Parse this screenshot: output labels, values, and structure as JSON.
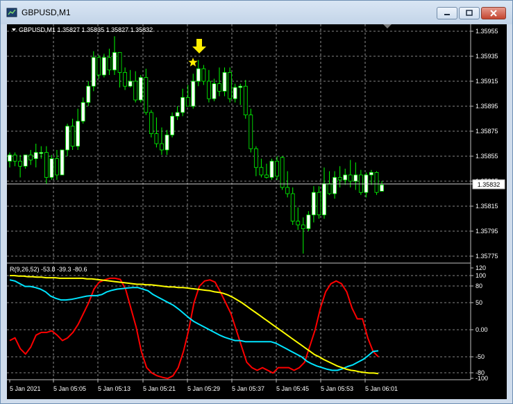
{
  "window": {
    "title": "GBPUSD,M1"
  },
  "chart_header": {
    "text": "GBPUSD,M1  1.35827 1.35835 1.35827 1.35832"
  },
  "indicator_header": {
    "text": "R(9,26,52) -53.8 -39.3 -80.6"
  },
  "price_axis": {
    "labels": [
      "1.35955",
      "1.35935",
      "1.35915",
      "1.35895",
      "1.35875",
      "1.35855",
      "1.35835",
      "1.35815",
      "1.35795",
      "1.35775"
    ],
    "current_price": "1.35832"
  },
  "indicator_axis": {
    "labels": [
      "120",
      "100",
      "80",
      "50",
      "0.00",
      "-50",
      "-80",
      "-100"
    ]
  },
  "time_axis": {
    "labels": [
      "5 Jan 2021",
      "5 Jan 05:05",
      "5 Jan 05:13",
      "5 Jan 05:21",
      "5 Jan 05:29",
      "5 Jan 05:37",
      "5 Jan 05:45",
      "5 Jan 05:53",
      "5 Jan 06:01"
    ]
  },
  "colors": {
    "bull": "#ffffff",
    "bear": "#000000",
    "candle_border": "#00ff00",
    "grid": "#b3b3b3",
    "fast_line": "#ff0000",
    "mid_line": "#00e5ff",
    "slow_line": "#ffff00",
    "marker": "#ffee00"
  },
  "markers": [
    {
      "icon": "arrow-down-icon"
    },
    {
      "icon": "star-icon"
    }
  ],
  "chart_data": [
    {
      "type": "candlestick",
      "title": "GBPUSD,M1",
      "ylim": [
        1.3577,
        1.3596
      ],
      "candles": [
        {
          "o": 1.35851,
          "h": 1.35858,
          "l": 1.35846,
          "c": 1.35856
        },
        {
          "o": 1.35856,
          "h": 1.35858,
          "l": 1.35847,
          "c": 1.35851
        },
        {
          "o": 1.35851,
          "h": 1.35856,
          "l": 1.35838,
          "c": 1.35847
        },
        {
          "o": 1.35847,
          "h": 1.35856,
          "l": 1.35845,
          "c": 1.35856
        },
        {
          "o": 1.35856,
          "h": 1.3586,
          "l": 1.35848,
          "c": 1.35852
        },
        {
          "o": 1.35853,
          "h": 1.35865,
          "l": 1.35846,
          "c": 1.35858
        },
        {
          "o": 1.35858,
          "h": 1.35863,
          "l": 1.35853,
          "c": 1.35858
        },
        {
          "o": 1.35858,
          "h": 1.35863,
          "l": 1.35833,
          "c": 1.35838
        },
        {
          "o": 1.35838,
          "h": 1.35856,
          "l": 1.35836,
          "c": 1.35853
        },
        {
          "o": 1.35853,
          "h": 1.3586,
          "l": 1.35836,
          "c": 1.3584
        },
        {
          "o": 1.3584,
          "h": 1.3586,
          "l": 1.3584,
          "c": 1.3586
        },
        {
          "o": 1.3586,
          "h": 1.35881,
          "l": 1.35855,
          "c": 1.35879
        },
        {
          "o": 1.35879,
          "h": 1.35885,
          "l": 1.3586,
          "c": 1.35863
        },
        {
          "o": 1.35863,
          "h": 1.35893,
          "l": 1.3586,
          "c": 1.35883
        },
        {
          "o": 1.35883,
          "h": 1.35902,
          "l": 1.35881,
          "c": 1.35898
        },
        {
          "o": 1.35898,
          "h": 1.35915,
          "l": 1.35895,
          "c": 1.35911
        },
        {
          "o": 1.35911,
          "h": 1.35939,
          "l": 1.35907,
          "c": 1.35934
        },
        {
          "o": 1.35934,
          "h": 1.35936,
          "l": 1.35917,
          "c": 1.3592
        },
        {
          "o": 1.3592,
          "h": 1.35937,
          "l": 1.35918,
          "c": 1.35934
        },
        {
          "o": 1.35934,
          "h": 1.35941,
          "l": 1.3592,
          "c": 1.35924
        },
        {
          "o": 1.35924,
          "h": 1.35951,
          "l": 1.3592,
          "c": 1.35938
        },
        {
          "o": 1.35938,
          "h": 1.35938,
          "l": 1.3591,
          "c": 1.35922
        },
        {
          "o": 1.35922,
          "h": 1.35926,
          "l": 1.35908,
          "c": 1.35911
        },
        {
          "o": 1.35911,
          "h": 1.35924,
          "l": 1.3591,
          "c": 1.35915
        },
        {
          "o": 1.35915,
          "h": 1.35923,
          "l": 1.35898,
          "c": 1.359
        },
        {
          "o": 1.359,
          "h": 1.3592,
          "l": 1.35898,
          "c": 1.35918
        },
        {
          "o": 1.35918,
          "h": 1.35925,
          "l": 1.35888,
          "c": 1.3589
        },
        {
          "o": 1.3589,
          "h": 1.35892,
          "l": 1.3587,
          "c": 1.35873
        },
        {
          "o": 1.35873,
          "h": 1.35886,
          "l": 1.35862,
          "c": 1.35865
        },
        {
          "o": 1.35865,
          "h": 1.35878,
          "l": 1.35856,
          "c": 1.3586
        },
        {
          "o": 1.3586,
          "h": 1.35876,
          "l": 1.35856,
          "c": 1.35872
        },
        {
          "o": 1.35872,
          "h": 1.3589,
          "l": 1.3587,
          "c": 1.35887
        },
        {
          "o": 1.35887,
          "h": 1.35895,
          "l": 1.35884,
          "c": 1.3589
        },
        {
          "o": 1.3589,
          "h": 1.35909,
          "l": 1.35887,
          "c": 1.35902
        },
        {
          "o": 1.35902,
          "h": 1.35912,
          "l": 1.359,
          "c": 1.35895
        },
        {
          "o": 1.35895,
          "h": 1.35921,
          "l": 1.35893,
          "c": 1.35915
        },
        {
          "o": 1.35915,
          "h": 1.35932,
          "l": 1.35911,
          "c": 1.35925
        },
        {
          "o": 1.35925,
          "h": 1.35928,
          "l": 1.35912,
          "c": 1.35915
        },
        {
          "o": 1.35915,
          "h": 1.35924,
          "l": 1.35898,
          "c": 1.35901
        },
        {
          "o": 1.35901,
          "h": 1.35917,
          "l": 1.35899,
          "c": 1.35913
        },
        {
          "o": 1.35913,
          "h": 1.35926,
          "l": 1.35903,
          "c": 1.35907
        },
        {
          "o": 1.35907,
          "h": 1.35926,
          "l": 1.35903,
          "c": 1.35922
        },
        {
          "o": 1.35922,
          "h": 1.35926,
          "l": 1.35898,
          "c": 1.35901
        },
        {
          "o": 1.35901,
          "h": 1.35913,
          "l": 1.35898,
          "c": 1.3591
        },
        {
          "o": 1.3591,
          "h": 1.35913,
          "l": 1.35896,
          "c": 1.35911
        },
        {
          "o": 1.35911,
          "h": 1.35916,
          "l": 1.35885,
          "c": 1.35888
        },
        {
          "o": 1.35888,
          "h": 1.35893,
          "l": 1.35858,
          "c": 1.35861
        },
        {
          "o": 1.35861,
          "h": 1.35863,
          "l": 1.35839,
          "c": 1.35846
        },
        {
          "o": 1.35846,
          "h": 1.35853,
          "l": 1.35838,
          "c": 1.3584
        },
        {
          "o": 1.3584,
          "h": 1.35849,
          "l": 1.35837,
          "c": 1.35838
        },
        {
          "o": 1.35838,
          "h": 1.35853,
          "l": 1.35836,
          "c": 1.35851
        },
        {
          "o": 1.35851,
          "h": 1.35855,
          "l": 1.35836,
          "c": 1.35839
        },
        {
          "o": 1.35854,
          "h": 1.35855,
          "l": 1.35828,
          "c": 1.3583
        },
        {
          "o": 1.3583,
          "h": 1.35843,
          "l": 1.35822,
          "c": 1.35825
        },
        {
          "o": 1.35825,
          "h": 1.3583,
          "l": 1.358,
          "c": 1.35803
        },
        {
          "o": 1.35803,
          "h": 1.35814,
          "l": 1.35796,
          "c": 1.358
        },
        {
          "o": 1.358,
          "h": 1.35806,
          "l": 1.35777,
          "c": 1.35797
        },
        {
          "o": 1.35797,
          "h": 1.35811,
          "l": 1.35795,
          "c": 1.35808
        },
        {
          "o": 1.35808,
          "h": 1.35831,
          "l": 1.35802,
          "c": 1.35826
        },
        {
          "o": 1.35826,
          "h": 1.35831,
          "l": 1.35805,
          "c": 1.35808
        },
        {
          "o": 1.35808,
          "h": 1.35846,
          "l": 1.35805,
          "c": 1.35833
        },
        {
          "o": 1.35833,
          "h": 1.35843,
          "l": 1.35824,
          "c": 1.35825
        },
        {
          "o": 1.35825,
          "h": 1.35843,
          "l": 1.35821,
          "c": 1.35838
        },
        {
          "o": 1.35838,
          "h": 1.35847,
          "l": 1.3583,
          "c": 1.35836
        },
        {
          "o": 1.35836,
          "h": 1.35845,
          "l": 1.35832,
          "c": 1.3584
        },
        {
          "o": 1.3584,
          "h": 1.35852,
          "l": 1.3583,
          "c": 1.35835
        },
        {
          "o": 1.35835,
          "h": 1.3585,
          "l": 1.35828,
          "c": 1.3584
        },
        {
          "o": 1.3584,
          "h": 1.35844,
          "l": 1.35824,
          "c": 1.35826
        },
        {
          "o": 1.35826,
          "h": 1.35842,
          "l": 1.35822,
          "c": 1.3584
        },
        {
          "o": 1.3584,
          "h": 1.35844,
          "l": 1.35832,
          "c": 1.35842
        },
        {
          "o": 1.35842,
          "h": 1.35843,
          "l": 1.35824,
          "c": 1.35826
        },
        {
          "o": 1.35827,
          "h": 1.35835,
          "l": 1.35827,
          "c": 1.35832
        }
      ]
    },
    {
      "type": "line",
      "title": "R(9,26,52)",
      "ylim": [
        -100,
        120
      ],
      "series": [
        {
          "name": "9",
          "values": [
            -20,
            -15,
            -35,
            -45,
            -32,
            -10,
            -5,
            -5,
            -2,
            -10,
            -20,
            -15,
            -5,
            10,
            30,
            50,
            75,
            88,
            92,
            95,
            95,
            93,
            75,
            40,
            5,
            -40,
            -70,
            -80,
            -85,
            -88,
            -90,
            -85,
            -70,
            -40,
            0,
            50,
            80,
            90,
            92,
            88,
            70,
            50,
            30,
            0,
            -30,
            -60,
            -70,
            -75,
            -70,
            -75,
            -80,
            -70,
            -70,
            -70,
            -75,
            -70,
            -60,
            -30,
            0,
            40,
            70,
            85,
            90,
            85,
            70,
            40,
            20,
            20,
            -15,
            -40,
            -50
          ]
        },
        {
          "name": "26",
          "values": [
            92,
            90,
            85,
            80,
            80,
            78,
            75,
            70,
            62,
            58,
            55,
            55,
            56,
            58,
            60,
            62,
            63,
            63,
            65,
            70,
            73,
            75,
            76,
            77,
            78,
            78,
            75,
            72,
            65,
            60,
            55,
            50,
            45,
            38,
            30,
            22,
            15,
            10,
            5,
            0,
            -5,
            -10,
            -14,
            -17,
            -20,
            -20,
            -22,
            -22,
            -22,
            -22,
            -22,
            -22,
            -25,
            -30,
            -35,
            -40,
            -45,
            -50,
            -58,
            -63,
            -67,
            -70,
            -73,
            -75,
            -75,
            -72,
            -68,
            -65,
            -60,
            -55,
            -48,
            -40,
            -39
          ]
        },
        {
          "name": "52",
          "values": [
            100,
            100,
            99,
            99,
            98,
            98,
            97,
            97,
            96,
            96,
            96,
            95,
            95,
            95,
            95,
            95,
            95,
            94,
            94,
            93,
            92,
            91,
            90,
            89,
            88,
            87,
            86,
            85,
            84,
            84,
            83,
            83,
            82,
            81,
            80,
            79,
            79,
            78,
            78,
            77,
            76,
            75,
            74,
            73,
            72,
            70,
            69,
            67,
            64,
            60,
            55,
            50,
            44,
            38,
            32,
            26,
            20,
            14,
            8,
            2,
            -4,
            -10,
            -16,
            -22,
            -28,
            -34,
            -40,
            -46,
            -50,
            -55,
            -59,
            -63,
            -67,
            -70,
            -73,
            -75,
            -76,
            -78,
            -79,
            -80,
            -80,
            -81
          ]
        }
      ]
    }
  ]
}
